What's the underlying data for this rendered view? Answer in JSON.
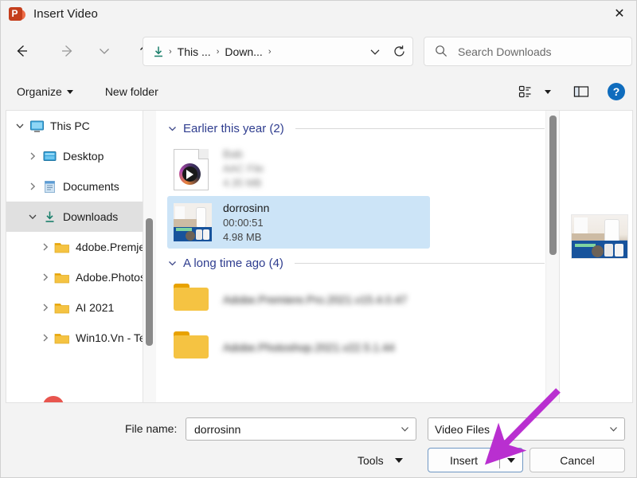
{
  "window": {
    "title": "Insert Video",
    "app_icon": "powerpoint-icon",
    "close_label": "✕"
  },
  "nav": {
    "back_label": "←",
    "forward_label": "→",
    "recent_label": "⌄",
    "up_label": "↑",
    "refresh_label": "⟳"
  },
  "address": {
    "location_icon": "downloads-arrow-icon",
    "crumbs": [
      "This ...",
      "Down..."
    ],
    "separator": "›",
    "trailing_separator": "›",
    "history_chevron": "⌄",
    "refresh": "⟳"
  },
  "search": {
    "placeholder": "Search Downloads",
    "value": "",
    "icon": "search-icon"
  },
  "commandbar": {
    "organize_label": "Organize",
    "new_folder_label": "New folder",
    "view_icon": "view-list-icon",
    "view_caret": "▾",
    "preview_pane_icon": "preview-pane-icon",
    "help_label": "?"
  },
  "sidebar": {
    "items": [
      {
        "label": "This PC",
        "icon": "monitor-icon",
        "chevron": "expanded",
        "indent": 0,
        "selected": false
      },
      {
        "label": "Desktop",
        "icon": "desktop-icon",
        "chevron": "collapsed",
        "indent": 1,
        "selected": false
      },
      {
        "label": "Documents",
        "icon": "documents-icon",
        "chevron": "collapsed",
        "indent": 1,
        "selected": false
      },
      {
        "label": "Downloads",
        "icon": "downloads-icon",
        "chevron": "expanded",
        "indent": 1,
        "selected": true
      },
      {
        "label": "4dobe.Premje",
        "icon": "folder-icon",
        "chevron": "collapsed",
        "indent": 2,
        "selected": false
      },
      {
        "label": "Adobe.Photos",
        "icon": "folder-icon",
        "chevron": "collapsed",
        "indent": 2,
        "selected": false
      },
      {
        "label": "AI 2021",
        "icon": "folder-icon",
        "chevron": "collapsed",
        "indent": 2,
        "selected": false
      },
      {
        "label": "Win10.Vn - Te",
        "icon": "folder-icon",
        "chevron": "collapsed",
        "indent": 2,
        "selected": false
      }
    ]
  },
  "filelist": {
    "groups": [
      {
        "title": "Earlier this year (2)",
        "chevron": "⌄",
        "items": [
          {
            "name": "Bab",
            "type_text": "AAC File",
            "size_text": "4.35 MB",
            "icon": "media-file-icon",
            "blurred": true,
            "selected": false
          },
          {
            "name": "dorrosinn",
            "type_text": "00:00:51",
            "size_text": "4.98 MB",
            "icon": "video-thumbnail",
            "blurred": false,
            "selected": true
          }
        ]
      },
      {
        "title": "A long time ago (4)",
        "chevron": "⌄",
        "items": [
          {
            "name": "Adobe.Premiere.Pro.2021.v15.4.0.47",
            "type_text": "",
            "size_text": "",
            "icon": "folder-icon",
            "blurred": true,
            "selected": false
          },
          {
            "name": "Adobe.Photoshop.2021.v22.5.1.44",
            "type_text": "",
            "size_text": "",
            "icon": "folder-icon",
            "blurred": true,
            "selected": false
          }
        ]
      }
    ]
  },
  "preview": {
    "thumbnail_name": "video-preview-thumbnail"
  },
  "footer": {
    "file_name_label": "File name:",
    "file_name_value": "dorrosinn",
    "file_name_placeholder": "File name",
    "file_type_value": "Video Files",
    "tools_label": "Tools",
    "tools_caret": "▾",
    "insert_label": "Insert",
    "insert_caret": "▾",
    "cancel_label": "Cancel"
  },
  "annotation": {
    "arrow_color": "#b92fd0",
    "arrow_name": "insert-button-callout-arrow"
  },
  "colors": {
    "selection_blue": "#cce4f7",
    "group_header": "#2f3d8f",
    "accent_button_border": "#6f97c4",
    "help_blue": "#0f6cbd",
    "window_bg": "#f3f3f3"
  }
}
